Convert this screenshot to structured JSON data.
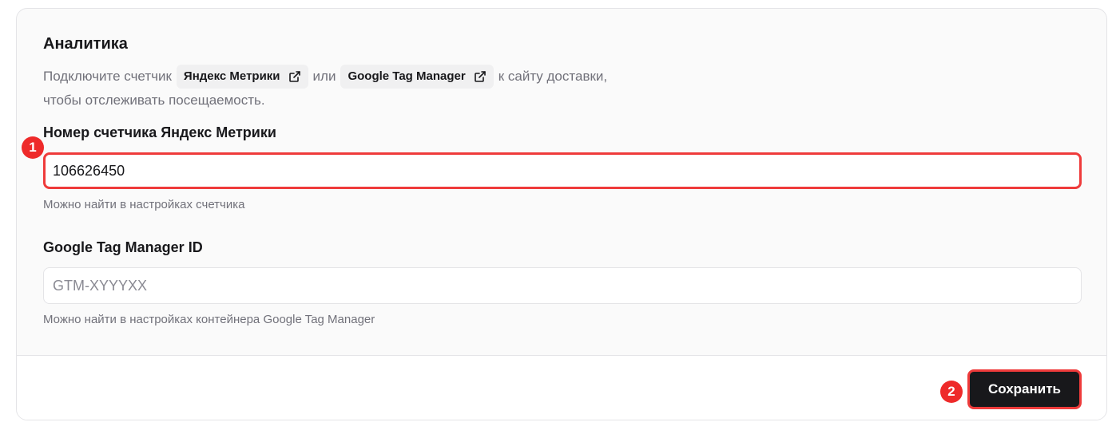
{
  "section": {
    "title": "Аналитика",
    "description": {
      "before_first_link": "Подключите счетчик",
      "first_link": "Яндекс Метрики",
      "between_links": "или",
      "second_link": "Google Tag Manager",
      "after_second_link": "к сайту доставки,",
      "line2": "чтобы отслеживать посещаемость."
    }
  },
  "fields": {
    "yandex": {
      "label": "Номер счетчика Яндекс Метрики",
      "value": "106626450",
      "placeholder": "",
      "hint": "Можно найти в настройках счетчика"
    },
    "gtm": {
      "label": "Google Tag Manager ID",
      "value": "",
      "placeholder": "GTM-XYYYXX",
      "hint": "Можно найти в настройках контейнера Google Tag Manager"
    }
  },
  "footer": {
    "save_label": "Сохранить"
  },
  "markers": {
    "first": "1",
    "second": "2"
  },
  "colors": {
    "accent_highlight": "#ef3b3b",
    "marker": "#ee2a2a",
    "primary_button": "#18181b",
    "muted_text": "#71717a",
    "card_background": "#fafafa"
  },
  "icons": {
    "external_link": "external-link-icon"
  }
}
